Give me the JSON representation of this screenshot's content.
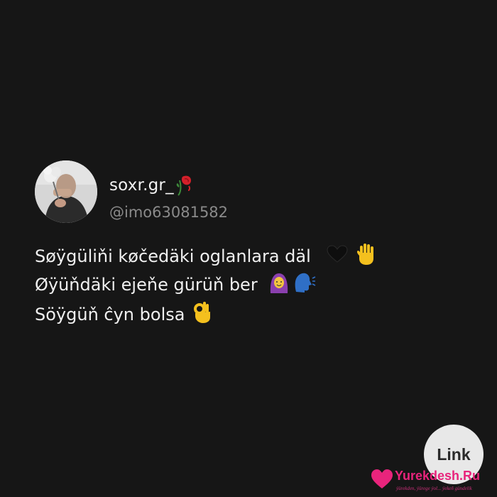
{
  "post": {
    "username": "soxr.gr_",
    "handle": "@imo63081582",
    "lines": [
      "Søÿgüliňi køčedäki oglanlara däl",
      "Øÿüňdäki ejeňe gürüň ber",
      "Söÿgüň ĉyn bolsa"
    ]
  },
  "link_button": {
    "label": "Link"
  },
  "watermark": {
    "name": "Yurekdesh.Ru",
    "tagline": "ýürekden, ýürege ýol... ýekeň gündelik"
  },
  "icons": {
    "username_suffix": "wilted-rose-icon",
    "line1": [
      "black-heart-icon",
      "raised-hand-icon"
    ],
    "line2": [
      "woman-with-headscarf-icon",
      "speaking-head-icon"
    ],
    "line3": [
      "ok-hand-icon"
    ],
    "watermark": "heart-icon"
  },
  "colors": {
    "background": "#161616",
    "handle": "#8a8a8a",
    "link_button": "#e8e8e8",
    "watermark": "#e8247c"
  }
}
